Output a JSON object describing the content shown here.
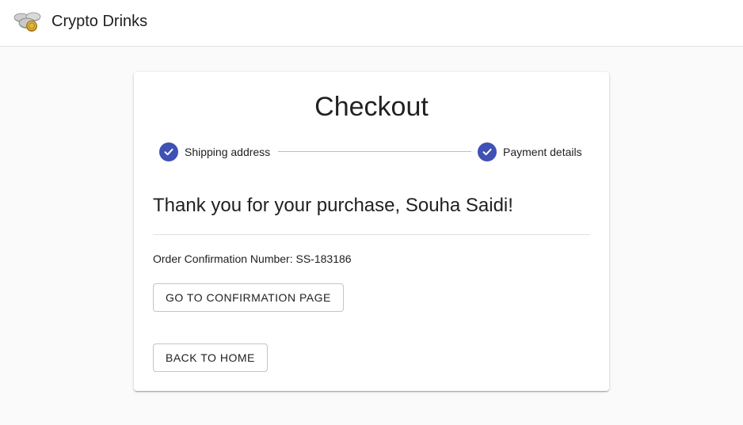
{
  "header": {
    "brand": "Crypto Drinks",
    "logo_icon": "coins-icon"
  },
  "checkout": {
    "title": "Checkout",
    "accent_color": "#3f51b5",
    "steps": [
      {
        "label": "Shipping address",
        "status": "completed",
        "icon": "check-circle-icon"
      },
      {
        "label": "Payment details",
        "status": "completed",
        "icon": "check-circle-icon"
      }
    ],
    "thanks_message": "Thank you for your purchase, Souha Saidi!",
    "order_confirmation": "Order Confirmation Number: SS-183186",
    "confirmation_button": "Go to confirmation page",
    "home_button": "Back to home"
  }
}
